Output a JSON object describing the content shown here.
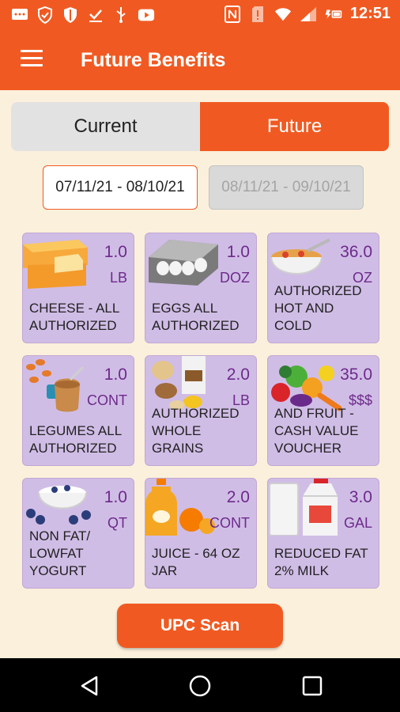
{
  "status_bar": {
    "time": "12:51",
    "icons": [
      "message-icon",
      "shield-icon",
      "shield-icon",
      "check-icon",
      "usb-icon",
      "youtube-icon",
      "nfc-icon",
      "sim-alert-icon",
      "wifi-icon",
      "signal-icon",
      "battery-charging-icon"
    ]
  },
  "app_bar": {
    "title": "Future Benefits",
    "menu_icon": "hamburger-menu-icon"
  },
  "toggle": {
    "current_label": "Current",
    "future_label": "Future",
    "selected": "Future"
  },
  "dates": {
    "current_range": "07/11/21 - 08/10/21",
    "future_range": "08/11/21 - 09/10/21"
  },
  "benefits": [
    {
      "qty": "1.0",
      "unit": "LB",
      "desc": [
        "CHEESE - ALL",
        "AUTHORIZED"
      ]
    },
    {
      "qty": "1.0",
      "unit": "DOZ",
      "desc": [
        "EGGS ALL",
        "AUTHORIZED"
      ]
    },
    {
      "qty": "36.0",
      "unit": "OZ",
      "desc": [
        "AUTHORIZED",
        "HOT AND",
        "COLD"
      ]
    },
    {
      "qty": "1.0",
      "unit": "CONT",
      "desc": [
        "LEGUMES ALL",
        "AUTHORIZED"
      ]
    },
    {
      "qty": "2.0",
      "unit": "LB",
      "desc": [
        "AUTHORIZED",
        "WHOLE",
        "GRAINS"
      ]
    },
    {
      "qty": "35.0",
      "unit": "$$$",
      "desc": [
        "AND FRUIT -",
        "CASH VALUE",
        "VOUCHER"
      ]
    },
    {
      "qty": "1.0",
      "unit": "QT",
      "desc": [
        "NON FAT/",
        "LOWFAT",
        "YOGURT"
      ]
    },
    {
      "qty": "2.0",
      "unit": "CONT",
      "desc": [
        "JUICE - 64 OZ",
        "JAR"
      ]
    },
    {
      "qty": "3.0",
      "unit": "GAL",
      "desc": [
        "REDUCED FAT",
        "2% MILK"
      ]
    }
  ],
  "upc_button": {
    "label": "UPC Scan"
  },
  "nav_bar": {
    "icons": [
      "back-icon",
      "home-icon",
      "recent-apps-icon"
    ]
  },
  "colors": {
    "primary": "#f05a22",
    "background": "#fbf0dc",
    "card": "#d0bde6",
    "qty_text": "#6d2a8a"
  }
}
